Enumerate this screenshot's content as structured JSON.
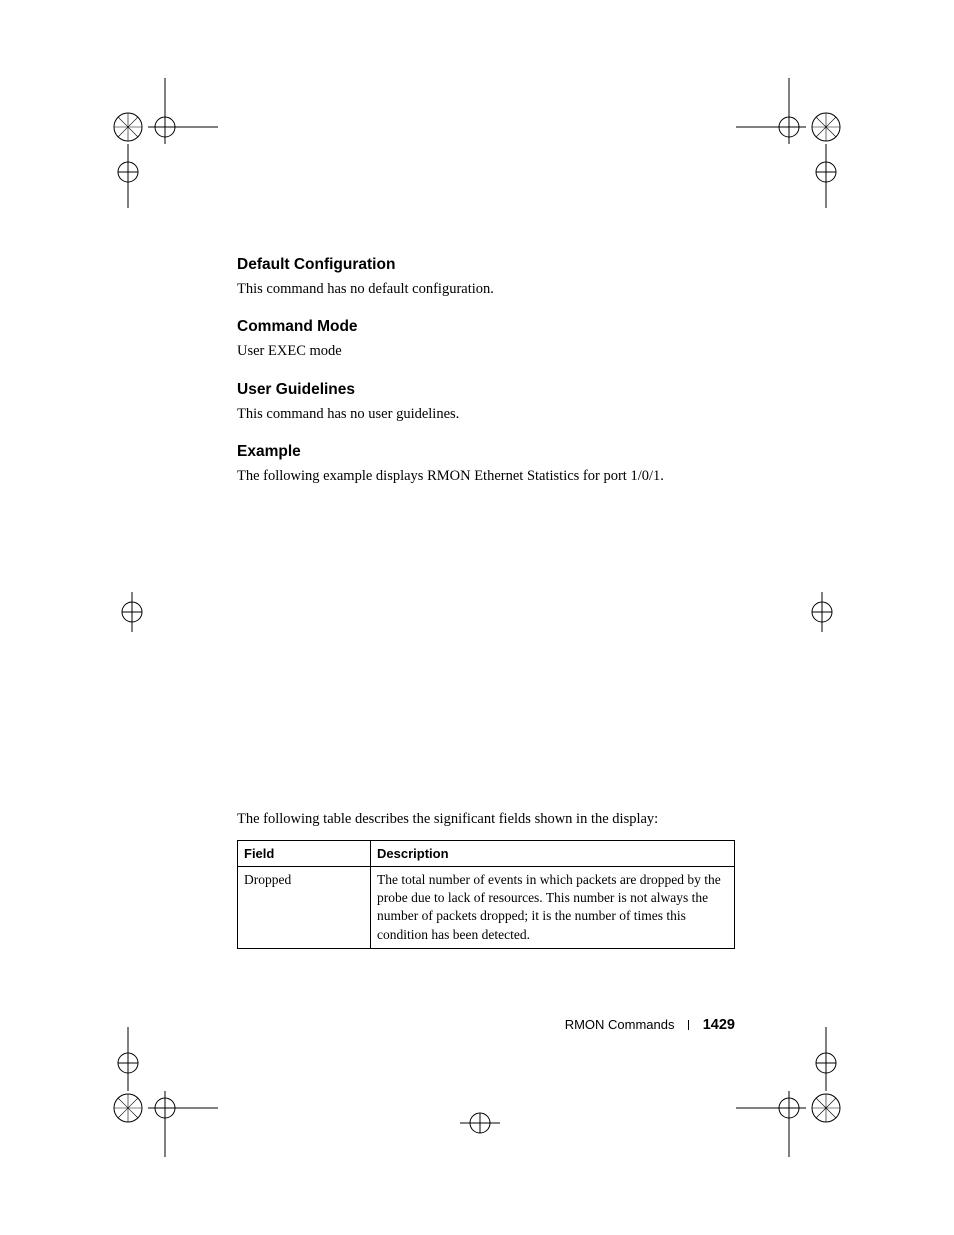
{
  "sections": {
    "default_config": {
      "heading": "Default Configuration",
      "body": "This command has no default configuration."
    },
    "command_mode": {
      "heading": "Command Mode",
      "body": "User EXEC mode"
    },
    "user_guidelines": {
      "heading": "User Guidelines",
      "body": "This command has no user guidelines."
    },
    "example": {
      "heading": "Example",
      "body": "The following example displays RMON Ethernet Statistics for port 1/0/1."
    }
  },
  "table_intro": "The following table describes the significant fields shown in the display:",
  "table": {
    "headers": {
      "field": "Field",
      "description": "Description"
    },
    "rows": [
      {
        "field": "Dropped",
        "description": "The total number of events in which packets are dropped by the probe due to lack of resources. This number is not always the number of packets dropped; it is the number of times this condition has been detected."
      }
    ]
  },
  "footer": {
    "section": "RMON Commands",
    "page": "1429"
  }
}
